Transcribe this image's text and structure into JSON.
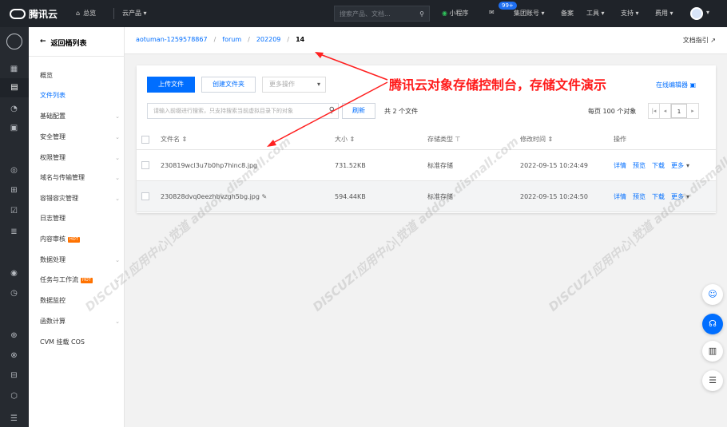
{
  "topbar": {
    "brand": "腾讯云",
    "home": "总览",
    "products": "云产品",
    "search_placeholder": "搜索产品、文档...",
    "mini_program": "小程序",
    "badge": "99+",
    "group_account": "集团账号",
    "beian": "备案",
    "tools": "工具",
    "support": "支持",
    "billing": "费用"
  },
  "sidebar": {
    "back": "返回桶列表",
    "items": [
      {
        "label": "概览",
        "chev": false,
        "hot": false
      },
      {
        "label": "文件列表",
        "chev": false,
        "hot": false
      },
      {
        "label": "基础配置",
        "chev": true,
        "hot": false
      },
      {
        "label": "安全管理",
        "chev": true,
        "hot": false
      },
      {
        "label": "权限管理",
        "chev": true,
        "hot": false
      },
      {
        "label": "域名与传输管理",
        "chev": true,
        "hot": false
      },
      {
        "label": "容错容灾管理",
        "chev": true,
        "hot": false
      },
      {
        "label": "日志管理",
        "chev": false,
        "hot": false
      },
      {
        "label": "内容审核",
        "chev": false,
        "hot": true
      },
      {
        "label": "数据处理",
        "chev": true,
        "hot": false
      },
      {
        "label": "任务与工作流",
        "chev": true,
        "hot": true
      },
      {
        "label": "数据监控",
        "chev": false,
        "hot": false
      },
      {
        "label": "函数计算",
        "chev": true,
        "hot": false
      },
      {
        "label": "CVM 挂载 COS",
        "chev": false,
        "hot": false
      }
    ],
    "hot_label": "HOT"
  },
  "breadcrumb": {
    "bucket": "aotuman-1259578867",
    "folder1": "forum",
    "folder2": "202209",
    "current": "14",
    "doc_guide": "文档指引"
  },
  "toolbar": {
    "upload": "上传文件",
    "create_folder": "创建文件夹",
    "more": "更多操作",
    "online_editor": "在线编辑器",
    "search_placeholder": "请输入前缀进行搜索，只支持搜索当前虚拟目录下的对象",
    "refresh": "刷新",
    "count": "共 2 个文件",
    "per_page": "每页 100 个对象",
    "page": "1"
  },
  "table": {
    "headers": {
      "name": "文件名",
      "size": "大小",
      "storage": "存储类型",
      "modified": "修改时间",
      "ops": "操作"
    },
    "rows": [
      {
        "name": "230819wcl3u7b0hp7hinc8.jpg",
        "size": "731.52KB",
        "storage": "标准存储",
        "modified": "2022-09-15 10:24:49"
      },
      {
        "name": "230828dvq0eezhbvzgh5bg.jpg",
        "size": "594.44KB",
        "storage": "标准存储",
        "modified": "2022-09-15 10:24:50"
      }
    ],
    "ops": {
      "detail": "详情",
      "preview": "预览",
      "download": "下载",
      "more": "更多"
    }
  },
  "annotation": "腾讯云对象存储控制台，存储文件演示",
  "watermark": "DISCUZ!应用中心|觉道 addon.dismall.com"
}
